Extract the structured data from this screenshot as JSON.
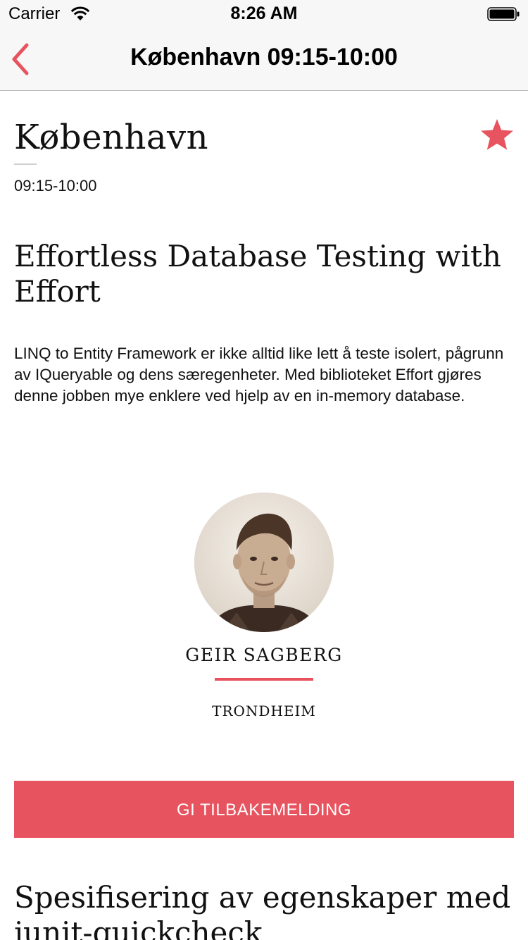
{
  "status_bar": {
    "carrier": "Carrier",
    "time": "8:26 AM",
    "wifi_icon": "wifi-icon",
    "battery_icon": "battery-icon"
  },
  "nav": {
    "title": "København 09:15-10:00",
    "back_icon": "chevron-left-icon"
  },
  "session": {
    "room": "København",
    "time_range": "09:15-10:00",
    "favorite_icon": "star-icon",
    "title": "Effortless Database Testing with Effort",
    "description": "LINQ to Entity Framework er ikke alltid like lett å teste isolert, pågrunn av IQueryable og dens særegenheter. Med biblioteket Effort gjøres denne jobben mye enklere ved hjelp av en in-memory database."
  },
  "speaker": {
    "name": "GEIR  SAGBERG",
    "city": "TRONDHEIM"
  },
  "actions": {
    "feedback_label": "GI TILBAKEMELDING"
  },
  "next_session": {
    "title": "Spesifisering av egenskaper med junit-quickcheck"
  },
  "colors": {
    "accent": "#e7535e",
    "nav_background": "#f7f7f7"
  }
}
